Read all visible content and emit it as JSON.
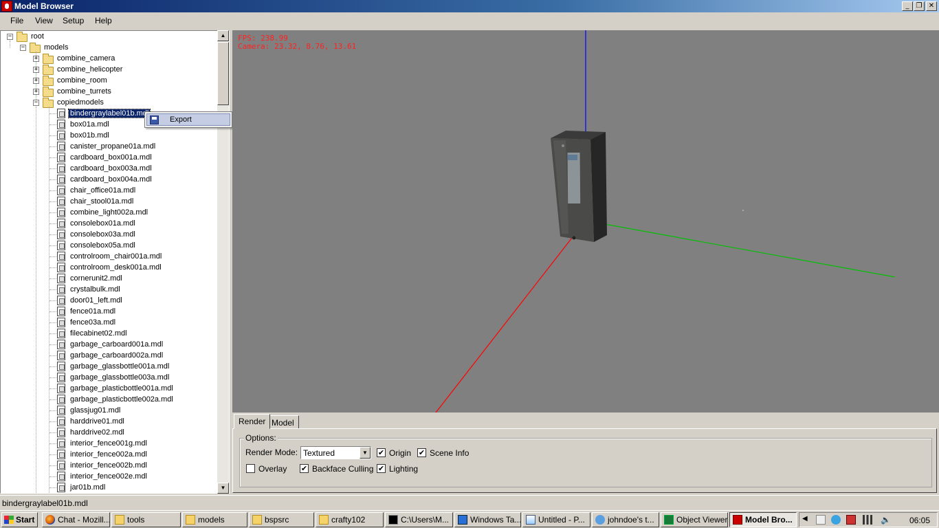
{
  "window": {
    "title": "Model Browser"
  },
  "menu": [
    "File",
    "View",
    "Setup",
    "Help"
  ],
  "tree": {
    "root": "root",
    "models": "models",
    "folders": [
      "combine_camera",
      "combine_helicopter",
      "combine_room",
      "combine_turrets",
      "copiedmodels"
    ],
    "files": [
      "bindergraylabel01b.mdl",
      "box01a.mdl",
      "box01b.mdl",
      "canister_propane01a.mdl",
      "cardboard_box001a.mdl",
      "cardboard_box003a.mdl",
      "cardboard_box004a.mdl",
      "chair_office01a.mdl",
      "chair_stool01a.mdl",
      "combine_light002a.mdl",
      "consolebox01a.mdl",
      "consolebox03a.mdl",
      "consolebox05a.mdl",
      "controlroom_chair001a.mdl",
      "controlroom_desk001a.mdl",
      "cornerunit2.mdl",
      "crystalbulk.mdl",
      "door01_left.mdl",
      "fence01a.mdl",
      "fence03a.mdl",
      "filecabinet02.mdl",
      "garbage_carboard001a.mdl",
      "garbage_carboard002a.mdl",
      "garbage_glassbottle001a.mdl",
      "garbage_glassbottle003a.mdl",
      "garbage_plasticbottle001a.mdl",
      "garbage_plasticbottle002a.mdl",
      "glassjug01.mdl",
      "harddrive01.mdl",
      "harddrive02.mdl",
      "interior_fence001g.mdl",
      "interior_fence002a.mdl",
      "interior_fence002b.mdl",
      "interior_fence002e.mdl",
      "jar01b.mdl"
    ],
    "selected_index": 0
  },
  "context_menu": {
    "export": "Export"
  },
  "viewport": {
    "fps": "FPS: 238.99",
    "camera": "Camera: 23.32, 8.76, 13.61",
    "background": "#808080",
    "axis_colors": {
      "x": "#ff0000",
      "y": "#00c000",
      "z": "#0000ff"
    }
  },
  "tabs": {
    "render": "Render",
    "model": "Model"
  },
  "options": {
    "legend": "Options:",
    "render_mode_label": "Render Mode:",
    "render_mode_value": "Textured",
    "origin": {
      "label": "Origin",
      "checked": true
    },
    "scene_info": {
      "label": "Scene Info",
      "checked": true
    },
    "overlay": {
      "label": "Overlay",
      "checked": false
    },
    "backface_culling": {
      "label": "Backface Culling",
      "checked": true
    },
    "lighting": {
      "label": "Lighting",
      "checked": true
    }
  },
  "status": "bindergraylabel01b.mdl",
  "taskbar": {
    "start": "Start",
    "tasks": [
      {
        "label": "Chat - Mozill...",
        "icon": "firefox-icon"
      },
      {
        "label": "tools",
        "icon": "folder-icon"
      },
      {
        "label": "models",
        "icon": "folder-icon"
      },
      {
        "label": "bspsrc",
        "icon": "folder-icon"
      },
      {
        "label": "crafty102",
        "icon": "folder-icon"
      },
      {
        "label": "C:\\Users\\M...",
        "icon": "cmd-icon"
      },
      {
        "label": "Windows Ta...",
        "icon": "task-manager-icon"
      },
      {
        "label": "Untitled - P...",
        "icon": "paint-icon"
      },
      {
        "label": "johndoe's t...",
        "icon": "user-icon"
      },
      {
        "label": "Object Viewer",
        "icon": "object-viewer-icon"
      },
      {
        "label": "Model Bro...",
        "icon": "model-browser-icon"
      }
    ],
    "clock": "06:05"
  }
}
